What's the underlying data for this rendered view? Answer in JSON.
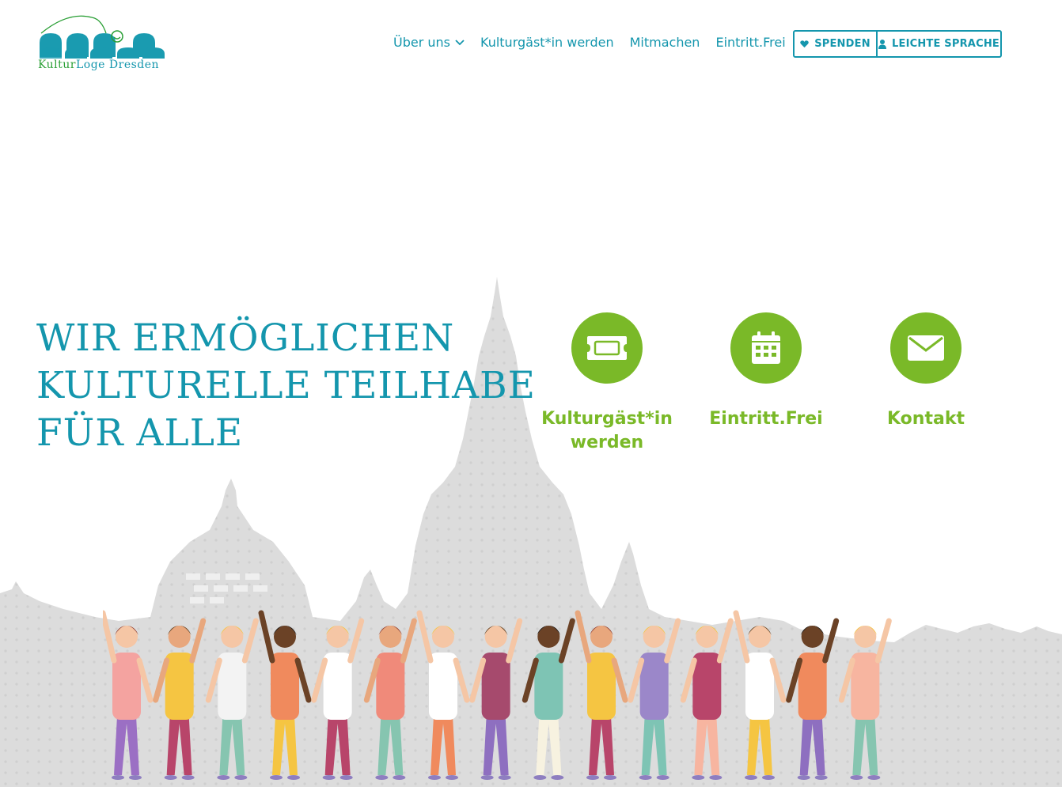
{
  "logo": {
    "name_part1": "Kultur",
    "name_part2": "Loge",
    "name_part3": " Dresden",
    "colors": {
      "teal": "#1496ad",
      "green": "#2a9f35"
    }
  },
  "nav": {
    "items": [
      {
        "label": "Über uns",
        "has_dropdown": true
      },
      {
        "label": "Kulturgäst*in werden",
        "has_dropdown": false
      },
      {
        "label": "Mitmachen",
        "has_dropdown": false
      },
      {
        "label": "Eintritt.Frei",
        "has_dropdown": false
      }
    ],
    "buttons": {
      "donate": {
        "label": "SPENDEN",
        "icon": "heart-icon"
      },
      "easy_language": {
        "label": "LEICHTE SPRACHE",
        "icon": "user-icon"
      }
    }
  },
  "hero": {
    "headline": [
      "WIR ERMÖGLICHEN",
      "KULTURELLE TEILHABE",
      "FÜR ALLE"
    ]
  },
  "quick_links": [
    {
      "label": "Kulturgäst*in werden",
      "icon": "ticket-icon"
    },
    {
      "label": "Eintritt.Frei",
      "icon": "calendar-icon"
    },
    {
      "label": "Kontakt",
      "icon": "envelope-icon"
    }
  ],
  "colors": {
    "primary": "#1496ad",
    "accent_green": "#7ab928",
    "skyline": "#dcdcdc"
  },
  "illustration": {
    "description_icon": "people-holding-hands-illustration",
    "background": "dresden-skyline-silhouette"
  }
}
